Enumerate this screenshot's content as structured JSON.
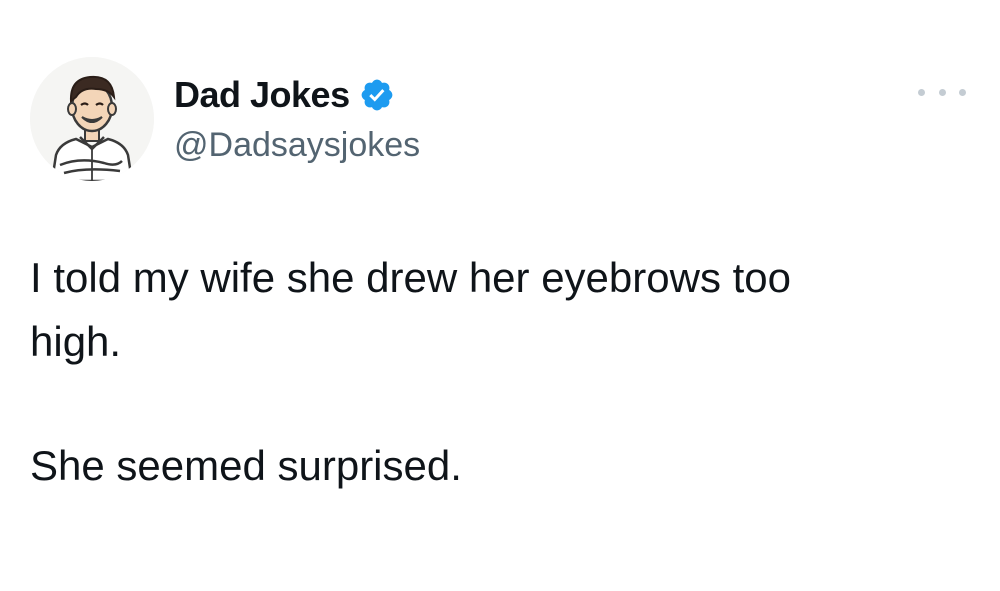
{
  "author": {
    "display_name": "Dad Jokes",
    "handle": "@Dadsaysjokes",
    "verified": true,
    "avatar_icon": "cartoon-man-avatar-icon",
    "verified_icon": "verified-badge-icon"
  },
  "menu": {
    "icon": "more-options-icon"
  },
  "tweet": {
    "lines": [
      "I told my wife she drew her eyebrows too",
      "high.",
      "She seemed surprised."
    ]
  },
  "colors": {
    "text": "#0f1419",
    "secondary_text": "#536471",
    "verified_blue": "#1d9bf0",
    "background": "#ffffff"
  }
}
